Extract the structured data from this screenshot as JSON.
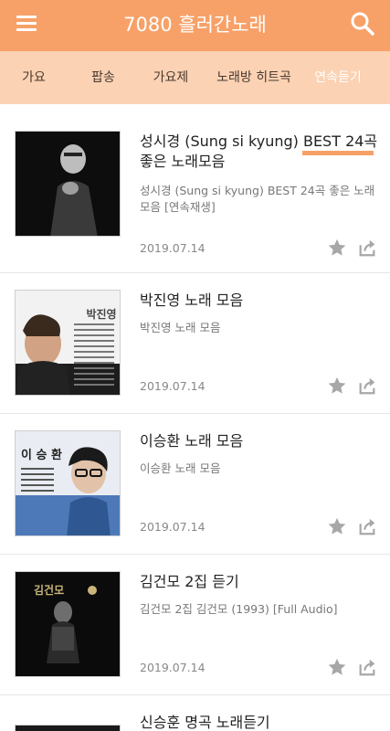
{
  "header": {
    "title": "7080 흘러간노래"
  },
  "tabs": [
    {
      "label": "가요"
    },
    {
      "label": "팝송"
    },
    {
      "label": "가요제"
    },
    {
      "label": "노래방 히트곡"
    },
    {
      "label": "연속듣기"
    }
  ],
  "items": [
    {
      "title": "성시경 (Sung si kyung) BEST 24곡 좋은 노래모음",
      "desc": "성시경 (Sung si kyung) BEST 24곡 좋은 노래모음 [연속재생]",
      "date": "2019.07.14"
    },
    {
      "title": "박진영 노래 모음",
      "desc": "박진영 노래 모음",
      "date": "2019.07.14",
      "thumb_text": "박진영"
    },
    {
      "title": "이승환 노래 모음",
      "desc": "이승환 노래 모음",
      "date": "2019.07.14",
      "thumb_text": "이 승 환"
    },
    {
      "title": "김건모 2집 듣기",
      "desc": "김건모 2집 김건모 (1993) [Full Audio]",
      "date": "2019.07.14",
      "thumb_text": "김건모"
    },
    {
      "title": "신승훈 명곡 노래듣기"
    }
  ],
  "colors": {
    "accent": "#f7a168",
    "tab_bar": "#fbd2b3",
    "icon_gray": "#a7a7a7"
  }
}
